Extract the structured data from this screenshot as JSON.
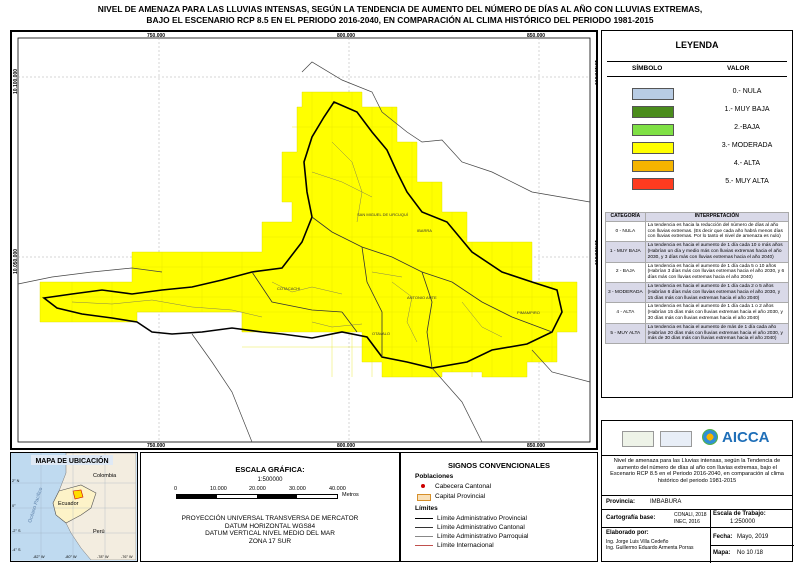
{
  "title": {
    "line1": "NIVEL DE AMENAZA PARA LAS LLUVIAS INTENSAS, SEGÚN LA TENDENCIA DE AUMENTO DEL NÚMERO DE DÍAS AL AÑO CON LLUVIAS EXTREMAS,",
    "line2": "BAJO EL ESCENARIO RCP 8.5 EN EL PERIODO 2016-2040, EN COMPARACIÓN AL CLIMA HISTÓRICO DEL PERIODO 1981-2015"
  },
  "map": {
    "x_ticks": [
      "750.000",
      "800.000",
      "850.000"
    ],
    "y_ticks": [
      "10.100.000",
      "10.050.000"
    ],
    "place_labels": [
      "SAN MIGUEL DE URCUQUÍ",
      "IBARRA",
      "COTACACHI",
      "ANTONIO ANTE",
      "PIMAMPIRO",
      "OTAVALO"
    ],
    "fill_color": "#ffff00"
  },
  "legend": {
    "title": "LEYENDA",
    "col_symbol": "SÍMBOLO",
    "col_value": "VALOR",
    "items": [
      {
        "label": "0.- NULA",
        "color": "#b8cce4"
      },
      {
        "label": "1.- MUY BAJA",
        "color": "#4a8c1c"
      },
      {
        "label": "2.-BAJA",
        "color": "#7fe045"
      },
      {
        "label": "3.- MODERADA",
        "color": "#ffff00"
      },
      {
        "label": "4.- ALTA",
        "color": "#f5b400"
      },
      {
        "label": "5.- MUY ALTA",
        "color": "#ff3b1f"
      }
    ]
  },
  "interpretation": {
    "col_category": "CATEGORÍA",
    "col_interp": "INTERPRETACIÓN",
    "rows": [
      {
        "category": "0 - NULA",
        "text": "La tendencia es hacia la reducción del número de días al año con lluvias extremas. (Es decir que cada año habrá menos días con lluvias extremas. Por lo tanto el nivel de amenaza es nulo)"
      },
      {
        "category": "1 - MUY BAJA",
        "text": "La tendencia es hacia el aumento de 1 día cada 10 o más años (Habrían un día y medio más con lluvias extremas hacia el año 2030, y 3 días más con lluvias extremas hacia el año 2040)"
      },
      {
        "category": "2 - BAJA",
        "text": "La tendencia es hacia el aumento de 1 día cada 5 o 10 años (Habrían 3 días más con lluvias extremas hacia el año 2030, y 6 días más con lluvias extremas hacia el año 2040)"
      },
      {
        "category": "3 - MODERADA",
        "text": "La tendencia es hacia el aumento de 1 día cada 2 o 5 años (Habrían 6 días más con lluvias extremas hacia el año 2030, y 15 días más con lluvias extremas hacia el año 2040)"
      },
      {
        "category": "4 - ALTA",
        "text": "La tendencia es hacia el aumento de 1 día cada 1 o 2 años (Habrían 15 días más con lluvias extremas hacia el año 2030, y 30 días más con lluvias extremas hacia el año 2040)"
      },
      {
        "category": "5 - MUY ALTA",
        "text": "La tendencia es hacia el aumento de más de 1 día cada año (Habrían 20 días más con lluvias extremas hacia el año 2030, y más de 30 días más con lluvias extremas hacia el año 2040)"
      }
    ]
  },
  "location_map": {
    "title": "MAPA DE UBICACIÓN",
    "labels": [
      "Colombia",
      "Ecuador",
      "Perú",
      "Océano Pacífico"
    ],
    "lon_ticks": [
      "-82° W",
      "-80° W",
      "-78° W",
      "-76° W"
    ],
    "lat_ticks": [
      "2° N",
      "0°",
      "-2° S",
      "-4° S"
    ]
  },
  "scale": {
    "title": "ESCALA GRÁFICA:",
    "ratio": "1:500000",
    "ticks": [
      "0",
      "10.000",
      "20.000",
      "30.000",
      "40.000"
    ],
    "unit": "Metros",
    "projection": [
      "PROYECCIÓN UNIVERSAL TRANSVERSA DE MERCATOR",
      "DATUM HORIZONTAL WGS84",
      "DATUM VERTICAL NIVEL MEDIO DEL MAR",
      "ZONA 17 SUR"
    ]
  },
  "signs": {
    "title": "SIGNOS CONVENCIONALES",
    "poblaciones": "Poblaciones",
    "cabecera": "Cabecera Cantonal",
    "capital": "Capital Provincial",
    "limites": "Límites",
    "lines": [
      "Límite Administrativo Provincial",
      "Límite Administrativo Cantonal",
      "Límite Administrativo Parroquial",
      "Límite Internacional"
    ]
  },
  "info": {
    "logo_text": "AICCA",
    "description": "Nivel de amenaza para las Lluvias intensas, según la Tendencia de aumento del número de días al año con lluvias extremas, bajo el Escenario RCP 8.5 en el Periodo 2016-2040, en comparación al clima histórico del periodo 1981-2015",
    "provincia_label": "Provincia:",
    "provincia": "IMBABURA",
    "cartografia_label": "Cartografía base:",
    "cartografia_1": "CONALI, 2018",
    "cartografia_2": "INEC, 2016",
    "escala_label": "Escala de Trabajo:",
    "escala": "1:250000",
    "elaborado_label": "Elaborado por:",
    "elaborado_1": "Ing. Jorge Luis Villa Cedeño",
    "elaborado_2": "Ing. Guillermo Eduardo Armenta Porras",
    "fecha_label": "Fecha:",
    "fecha": "Mayo, 2019",
    "mapa_label": "Mapa:",
    "mapa": "No 10 /18"
  }
}
